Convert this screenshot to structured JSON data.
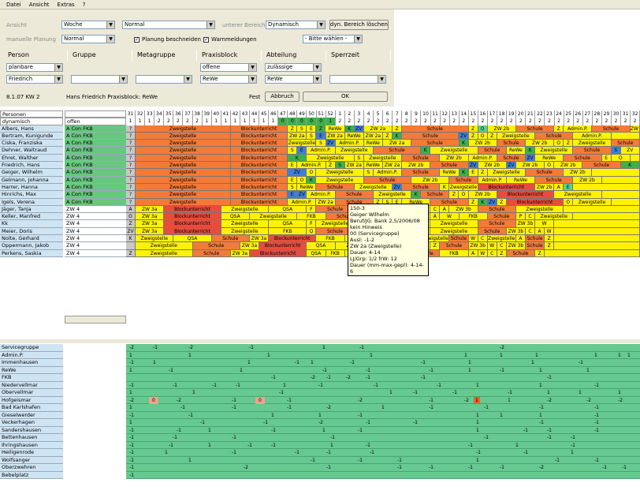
{
  "menu": [
    "Datei",
    "Ansicht",
    "Extras",
    "?"
  ],
  "filters": {
    "ansicht_label": "Ansicht",
    "ansicht_value": "Woche",
    "normal_value": "Normal",
    "unterer_bereich_label": "unterer Bereich",
    "unterer_bereich_value": "Dynamisch",
    "dyn_button": "dyn. Bereich löschen",
    "manuelle_label": "manuelle Planung",
    "manuelle_value": "Normal",
    "planung_cb": "Planung beschneiden",
    "warn_cb": "Warnmeldungen",
    "bitte_value": "- Bitte wählen -",
    "cols": [
      "Person",
      "Gruppe",
      "Metagruppe",
      "Praxisblock",
      "Abteilung",
      "Sperrzeit"
    ],
    "person_v1": "planbare",
    "person_v2": "Friedrich",
    "praxis_v1": "offene",
    "praxis_v2": "ReWe",
    "abteilung_v1": "zulässige",
    "abteilung_v2": "ReWe",
    "date": "8.1.07 KW 2",
    "info": "Hans Friedrich Praxisblock: ReWe",
    "fest": "Fest",
    "abbruch": "Abbruch",
    "ok": "OK"
  },
  "grid": {
    "header1": "Personen",
    "header2": "dynamisch",
    "offen": "offen",
    "weeks": [
      "31",
      "32",
      "33",
      "34",
      "35",
      "36",
      "37",
      "38",
      "39",
      "40",
      "41",
      "42",
      "43",
      "44",
      "45",
      "46",
      "47",
      "48",
      "49",
      "50",
      "51",
      "52",
      "1",
      "2",
      "3",
      "4",
      "5",
      "6",
      "7",
      "8",
      "9",
      "10",
      "11",
      "12",
      "13",
      "14",
      "15",
      "16",
      "17",
      "18",
      "19",
      "20",
      "21",
      "22",
      "23",
      "24",
      "25",
      "26",
      "27",
      "28",
      "29",
      "30",
      "31",
      "32"
    ],
    "persons": [
      "Albers, Hans",
      "Bertram, Kunigunde",
      "Ciska, Franziska",
      "Dehner, Waltraud",
      "Ehret, Walther",
      "Friedrich, Hans",
      "Geiger, Wilhelm",
      "Gelmann, Johanna",
      "Harrer, Hanna",
      "Hinrichs, Max",
      "Igels, Verena",
      "Jäger, Tanja",
      "Keller, Manfred",
      "Kk",
      "Meier, Doris",
      "Nolte, Gerhard",
      "Oppermann, Jakob",
      "Perkens, Saskia"
    ],
    "groups": [
      "A Con FKB",
      "A Con FKB",
      "A Con FKB",
      "A Con FKB",
      "A Con FKB",
      "A Con FKB",
      "A Con FKB",
      "A Con FKB",
      "A Con FKB",
      "A Con FKB",
      "A Con FKB",
      "ZW 4",
      "ZW 4",
      "ZW 4",
      "ZW 4",
      "ZW 4",
      "ZW 4",
      "ZW 4"
    ],
    "labels": {
      "zw": "Zweigstelle",
      "block": "Blockunterricht",
      "schule": "Schule",
      "rewe": "ReWe",
      "admin": "Admin.P.",
      "zw2a": "ZW 2a",
      "zw2b": "ZW 2b",
      "zw3a": "ZW 3a",
      "zw3b": "ZW 3b",
      "qsa": "QSA",
      "fkb": "FKB",
      "s": "S",
      "e": "E",
      "k": "K",
      "z": "Z",
      "o": "O",
      "p": "P",
      "c": "C",
      "w": "W",
      "a": "A",
      "q": "Q",
      "f": "F",
      "zv": "ZV",
      "q2": "?"
    }
  },
  "tooltip": [
    "150-3",
    "Geiger Wilhelm",
    "Beruf/JG: Bank 2,5/2006/08",
    "kein Hinweis",
    "00 (Servicegruppe)",
    "Ausl: -1-2",
    "ZW 2a (Zweigstelle)",
    "Dauer: 4-14",
    "LJ/Grp: 1/2 frW: 12",
    "Dauer (mm-max-gepl): 4-14-6"
  ],
  "summary": {
    "names": [
      "Servicegruppe",
      "Admin.P.",
      "Immenhausen",
      "ReWe",
      "FKB",
      "Niedervellmar",
      "Obervellmar",
      "Hofgeismar",
      "Bad Karlshafen",
      "Gieselwerder",
      "Veckerhagen",
      "Sandershausen",
      "Bettenhausen",
      "Ihringshausen",
      "Heiligenrode",
      "Wolfsanger",
      "Oberzwehren",
      "Bebelplatz"
    ],
    "vals": [
      "-2",
      "-1",
      "0",
      "1"
    ]
  }
}
